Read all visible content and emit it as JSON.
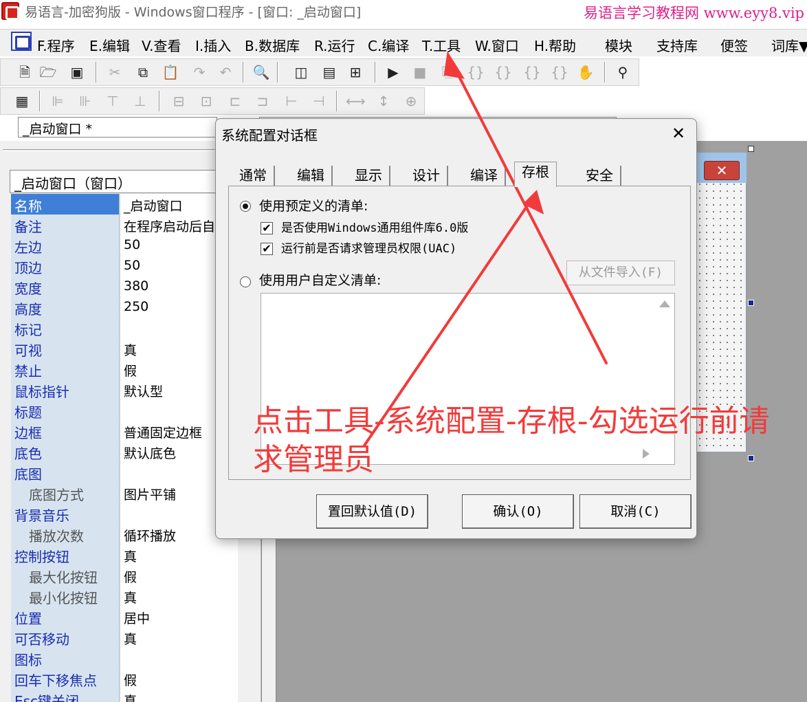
{
  "titlebar": {
    "title": "易语言-加密狗版 - Windows窗口程序 - [窗口: _启动窗口]",
    "watermark": "易语言学习教程网 www.eyy8.vip"
  },
  "menu": {
    "items": [
      "F.程序",
      "E.编辑",
      "V.查看",
      "I.插入",
      "B.数据库",
      "R.运行",
      "C.编译",
      "T.工具",
      "W.窗口",
      "H.帮助",
      "模块",
      "支持库",
      "便签",
      "词库▼"
    ]
  },
  "toolbar": {
    "icons": [
      "new-file-icon",
      "open-folder-icon",
      "save-icon",
      "cut-icon",
      "copy-icon",
      "paste-icon",
      "redo-icon",
      "undo-icon",
      "find-icon",
      "layout-1-icon",
      "layout-2-icon",
      "layout-3-icon",
      "run-icon",
      "stop-icon"
    ]
  },
  "combo": {
    "current": "_启动窗口 *"
  },
  "left_panel": {
    "object": "_启动窗口（窗口）",
    "properties": [
      {
        "name": "名称",
        "value": "_启动窗口",
        "selected": true
      },
      {
        "name": "备注",
        "value": "在程序启动后自"
      },
      {
        "name": "左边",
        "value": "50"
      },
      {
        "name": "顶边",
        "value": "50"
      },
      {
        "name": "宽度",
        "value": "380"
      },
      {
        "name": "高度",
        "value": "250"
      },
      {
        "name": "标记",
        "value": ""
      },
      {
        "name": "可视",
        "value": "真"
      },
      {
        "name": "禁止",
        "value": "假"
      },
      {
        "name": "鼠标指针",
        "value": "默认型"
      },
      {
        "name": "标题",
        "value": ""
      },
      {
        "name": "边框",
        "value": "普通固定边框"
      },
      {
        "name": "底色",
        "value": "默认底色"
      },
      {
        "name": "底图",
        "value": ""
      },
      {
        "name": "底图方式",
        "value": "图片平铺",
        "sub": true
      },
      {
        "name": "背景音乐",
        "value": ""
      },
      {
        "name": "播放次数",
        "value": "循环播放",
        "sub": true
      },
      {
        "name": "控制按钮",
        "value": "真"
      },
      {
        "name": "最大化按钮",
        "value": "假",
        "sub": true
      },
      {
        "name": "最小化按钮",
        "value": "真",
        "sub": true
      },
      {
        "name": "位置",
        "value": "居中"
      },
      {
        "name": "可否移动",
        "value": "真"
      },
      {
        "name": "图标",
        "value": ""
      },
      {
        "name": "回车下移焦点",
        "value": "假"
      },
      {
        "name": "Esc键关闭",
        "value": "真"
      }
    ]
  },
  "dialog": {
    "title": "系统配置对话框",
    "tabs": [
      "通常",
      "编辑",
      "显示",
      "设计",
      "编译",
      "存根",
      "安全"
    ],
    "active_tab": "存根",
    "radio_predefined": "使用预定义的清单:",
    "check_common_controls": "是否使用Windows通用组件库6.0版",
    "check_uac": "运行前是否请求管理员权限(UAC)",
    "radio_custom": "使用用户自定义清单:",
    "import_button": "从文件导入(F)",
    "buttons": {
      "reset": "置回默认值(D)",
      "ok": "确认(O)",
      "cancel": "取消(C)"
    }
  },
  "annotation": {
    "text": "点击工具-系统配置-存根-勾选运行前请求管理员",
    "color": "#f33a3a"
  },
  "colors": {
    "watermark": "#e0208a",
    "selection": "#3f7fd8",
    "prop_name_bg": "#d7e4f0"
  }
}
